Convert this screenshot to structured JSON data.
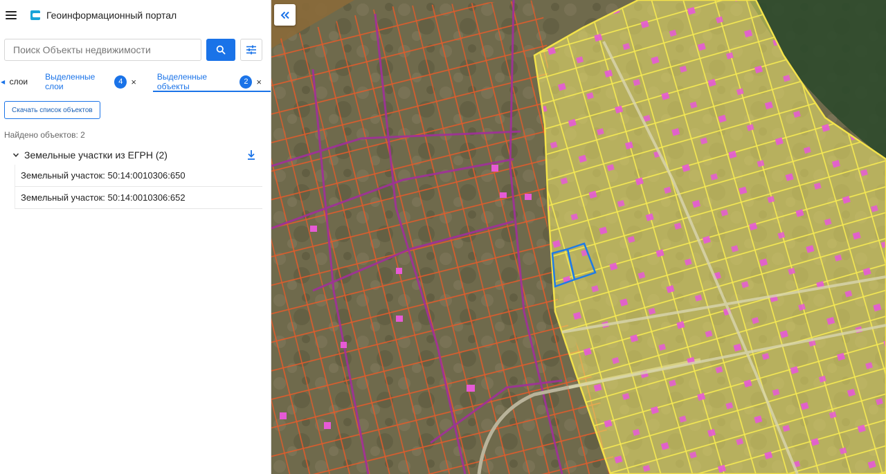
{
  "app": {
    "title": "Геоинформационный портал",
    "menu_icon": "hamburger-menu-icon",
    "logo_icon": "portal-logo-icon"
  },
  "search": {
    "placeholder": "Поиск Объекты недвижимости",
    "value": "",
    "button_icon": "search-icon",
    "filter_icon": "filter-settings-icon"
  },
  "tabs": {
    "layers": "слои",
    "selected_layers": {
      "label": "Выделенные слои",
      "count": "4"
    },
    "selected_objects": {
      "label": "Выделенные объекты",
      "count": "2"
    },
    "close_glyph": "×"
  },
  "results": {
    "download_list_label": "Скачать список объектов",
    "found_label": "Найдено объектов: 2",
    "group": {
      "title": "Земельные участки из ЕГРН (2)",
      "expanded": true,
      "items": [
        "Земельный участок: 50:14:0010306:650",
        "Земельный участок: 50:14:0010306:652"
      ]
    }
  },
  "map": {
    "collapse_icon": "double-chevron-left-icon"
  },
  "colors": {
    "accent": "#1a73e8",
    "zone_fill": "#f2ea6e",
    "zone_stroke": "#f3e24a",
    "parcel_orange": "#e55b2a",
    "road_magenta": "#a0309a",
    "building_pink": "#ea4dd8",
    "selected_parcel": "#1f7be6"
  }
}
